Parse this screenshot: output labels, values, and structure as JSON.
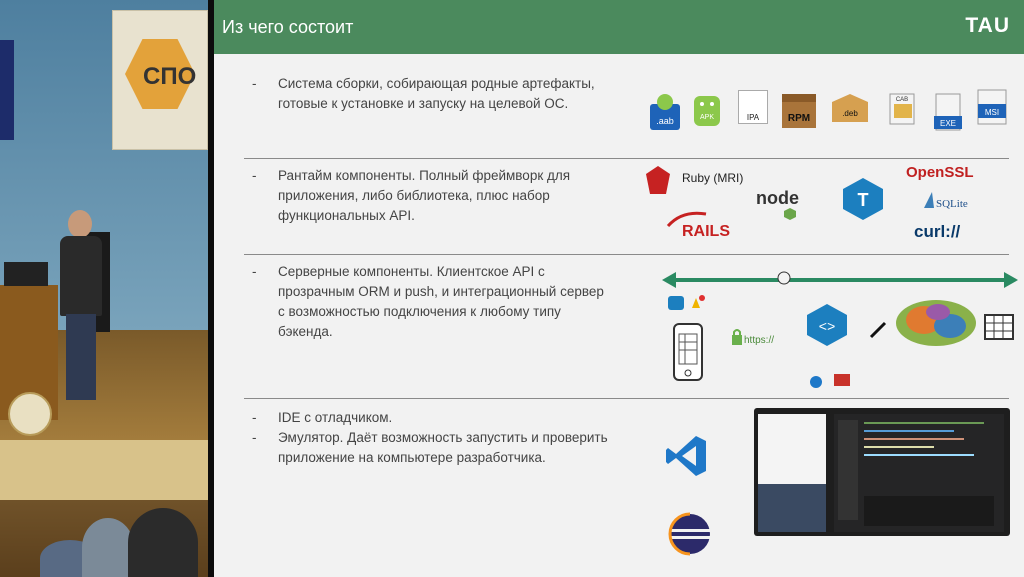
{
  "slide": {
    "title": "Из чего состоит",
    "logo": "TAU"
  },
  "sections": [
    {
      "bullets": [
        "Система сборки, собирающая родные артефакты, готовые к установке и запуску на целевой ОС."
      ]
    },
    {
      "bullets": [
        "Рантайм компоненты. Полный фреймворк для приложения, либо библиотека, плюс набор функциональных API."
      ]
    },
    {
      "bullets": [
        "Серверные компоненты. Клиентское API с прозрачным ORM и push, и интеграционный сервер с возможностью подключения к любому типу бэкенда."
      ]
    },
    {
      "bullets": [
        "IDE с отладчиком.",
        "Эмулятор. Даёт возможность запустить и проверить приложение на компьютере разработчика."
      ]
    }
  ],
  "build_icons": [
    ".aab",
    "APK",
    "IPA",
    "RPM",
    ".deb",
    "CAB",
    "EXE",
    "MSI"
  ],
  "runtime_labels": {
    "ruby": "Ruby (MRI)",
    "rails": "RAILS",
    "node": "node",
    "openssl": "OpenSSL",
    "sqlite": "SQLite",
    "curl": "curl://"
  },
  "server_labels": {
    "https": "https://"
  },
  "banner": {
    "text": "СПО"
  },
  "dash": "-",
  "colors": {
    "header": "#4b8a5d",
    "arrow": "#2a8a62",
    "vscode": "#1f78c8",
    "tau_tile": "#1c7fbf"
  }
}
